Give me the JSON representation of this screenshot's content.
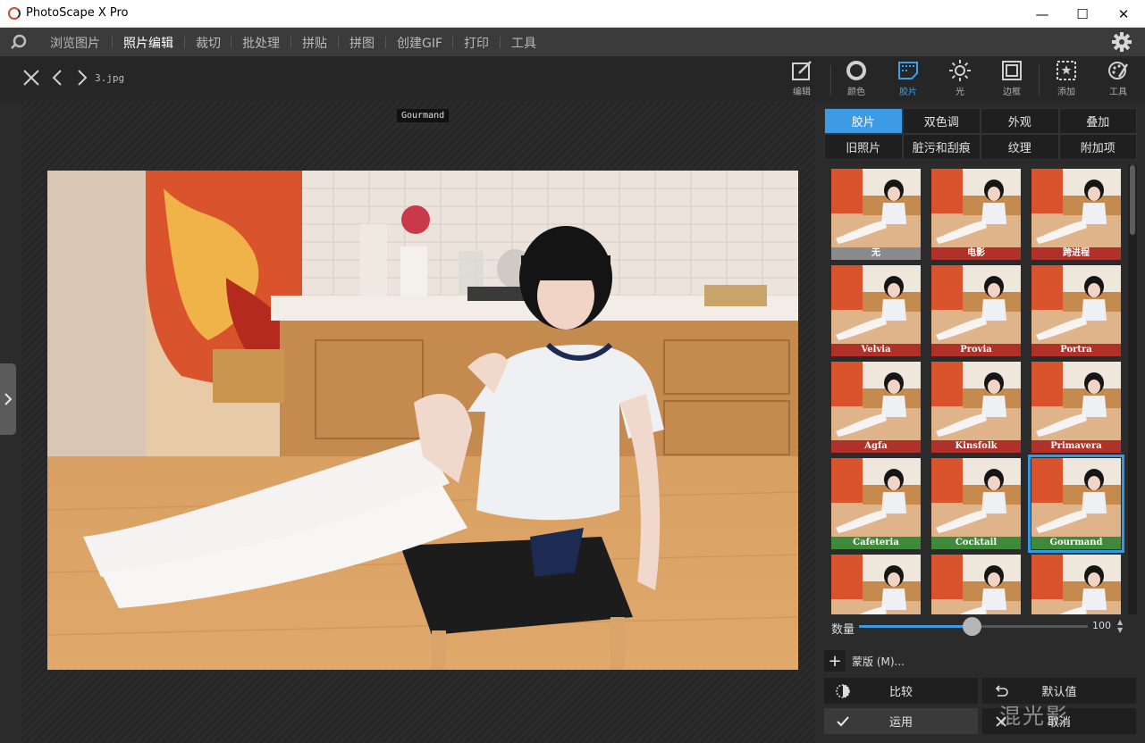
{
  "window": {
    "title": "PhotoScape X Pro",
    "controls": {
      "minimize": "—",
      "maximize": "☐",
      "close": "✕"
    }
  },
  "menu": {
    "items": [
      "浏览图片",
      "照片编辑",
      "裁切",
      "批处理",
      "拼贴",
      "拼图",
      "创建GIF",
      "打印",
      "工具"
    ],
    "active_index": 1
  },
  "toolbar": {
    "filename": "3.jpg",
    "tools": [
      {
        "label": "编辑",
        "icon": "edit-icon"
      },
      {
        "label": "颜色",
        "icon": "color-icon"
      },
      {
        "label": "胶片",
        "icon": "film-icon"
      },
      {
        "label": "光",
        "icon": "light-icon"
      },
      {
        "label": "边框",
        "icon": "frame-icon"
      },
      {
        "label": "添加",
        "icon": "add-icon"
      },
      {
        "label": "工具",
        "icon": "tools-icon"
      }
    ],
    "active_tool": "胶片"
  },
  "canvas": {
    "caption": "Gourmand"
  },
  "panel": {
    "tabs": [
      "胶片",
      "双色调",
      "外观",
      "叠加",
      "旧照片",
      "脏污和刮痕",
      "纹理",
      "附加项"
    ],
    "active_tab": "胶片",
    "filters": [
      {
        "name": "无",
        "label_color": "#8a8a8a"
      },
      {
        "name": "电影",
        "label_color": "#b0302a"
      },
      {
        "name": "跨进程",
        "label_color": "#b0302a"
      },
      {
        "name": "Velvia",
        "label_color": "#b0302a"
      },
      {
        "name": "Provia",
        "label_color": "#b0302a"
      },
      {
        "name": "Portra",
        "label_color": "#b0302a"
      },
      {
        "name": "Agfa",
        "label_color": "#b0302a"
      },
      {
        "name": "Kinsfolk",
        "label_color": "#b0302a"
      },
      {
        "name": "Primavera",
        "label_color": "#b0302a"
      },
      {
        "name": "Cafeteria",
        "label_color": "#3e8a3a"
      },
      {
        "name": "Cocktail",
        "label_color": "#3e8a3a"
      },
      {
        "name": "Gourmand",
        "label_color": "#3e8a3a"
      },
      {
        "name": "",
        "label_color": "#b0302a"
      },
      {
        "name": "",
        "label_color": "#b0302a"
      },
      {
        "name": "",
        "label_color": "#b0302a"
      }
    ],
    "selected_filter": "Gourmand",
    "amount": {
      "label": "数量",
      "value": "100",
      "fraction": 0.5
    },
    "mask_label": "蒙版 (M)...",
    "buttons": {
      "compare": "比较",
      "default": "默认值",
      "apply": "运用",
      "cancel": "取消"
    }
  },
  "watermark": "混光影",
  "colors": {
    "accent": "#3d9be6",
    "film_red": "#b0302a",
    "film_green": "#3e8a3a"
  }
}
